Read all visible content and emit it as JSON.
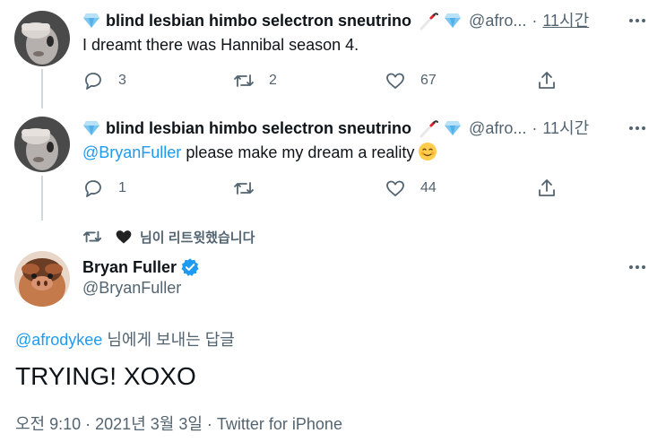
{
  "tweet1": {
    "display_name": "blind lesbian himbo selectron sneutrino",
    "handle": "@afro...",
    "separator": "·",
    "time": "11시간",
    "text": "I dreamt there was Hannibal season 4.",
    "replies": "3",
    "retweets": "2",
    "likes": "67"
  },
  "tweet2": {
    "display_name": "blind lesbian himbo selectron sneutrino",
    "handle": "@afro...",
    "separator": "·",
    "time": "11시간",
    "mention": "@BryanFuller",
    "text": " please make my dream a reality",
    "replies": "1",
    "retweets": "",
    "likes": "44"
  },
  "retweet_notice": "님이 리트윗했습니다",
  "main_tweet": {
    "display_name": "Bryan Fuller",
    "handle": "@BryanFuller",
    "reply_mention": "@afrodykee",
    "reply_suffix": " 님에게 보내는 답글",
    "text": "TRYING! XOXO",
    "meta": "오전 9:10 · 2021년 3월 3일 · Twitter for iPhone"
  },
  "colors": {
    "accent": "#1d9bf0",
    "secondary_text": "#536471",
    "thread_line": "#cfd9de"
  },
  "icons": [
    "diamond-icon",
    "white-cane-icon",
    "reply-icon",
    "retweet-icon",
    "like-icon",
    "share-icon",
    "more-icon",
    "heart-icon",
    "verified-icon",
    "smiling-face-emoji"
  ]
}
